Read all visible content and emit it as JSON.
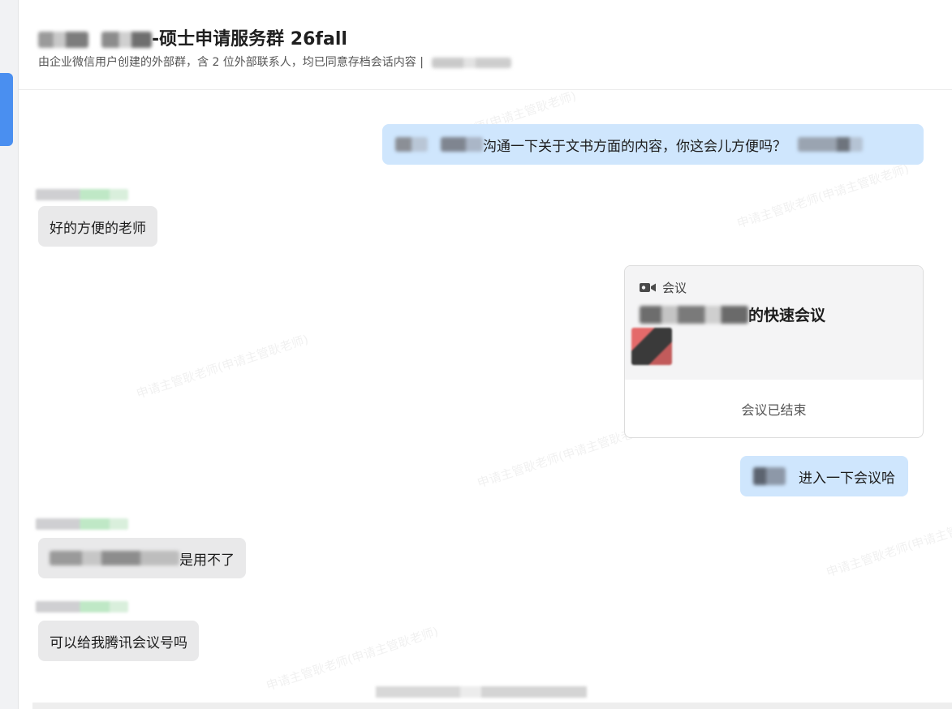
{
  "header": {
    "title": "-硕士申请服务群 26fall",
    "subtitle": "由企业微信用户创建的外部群，含 2 位外部联系人，均已同意存档会话内容 |"
  },
  "watermark_text": "申请主管耿老师(申请主管耿老师)",
  "messages": {
    "m1_text": "沟通一下关于文书方面的内容，你这会儿方便吗？",
    "m2_text": "好的方便的老师",
    "meeting": {
      "tag": "会议",
      "title_suffix": "的快速会议",
      "status": "会议已结束",
      "icon": "video-camera-icon"
    },
    "m4_text": "进入一下会议哈",
    "m5_text": "是用不了",
    "m6_text": "可以给我腾讯会议号吗"
  },
  "colors": {
    "outgoing_bubble": "#cfe6fd",
    "incoming_bubble": "#e9e9ea",
    "accent_tab": "#4a8ff0"
  }
}
